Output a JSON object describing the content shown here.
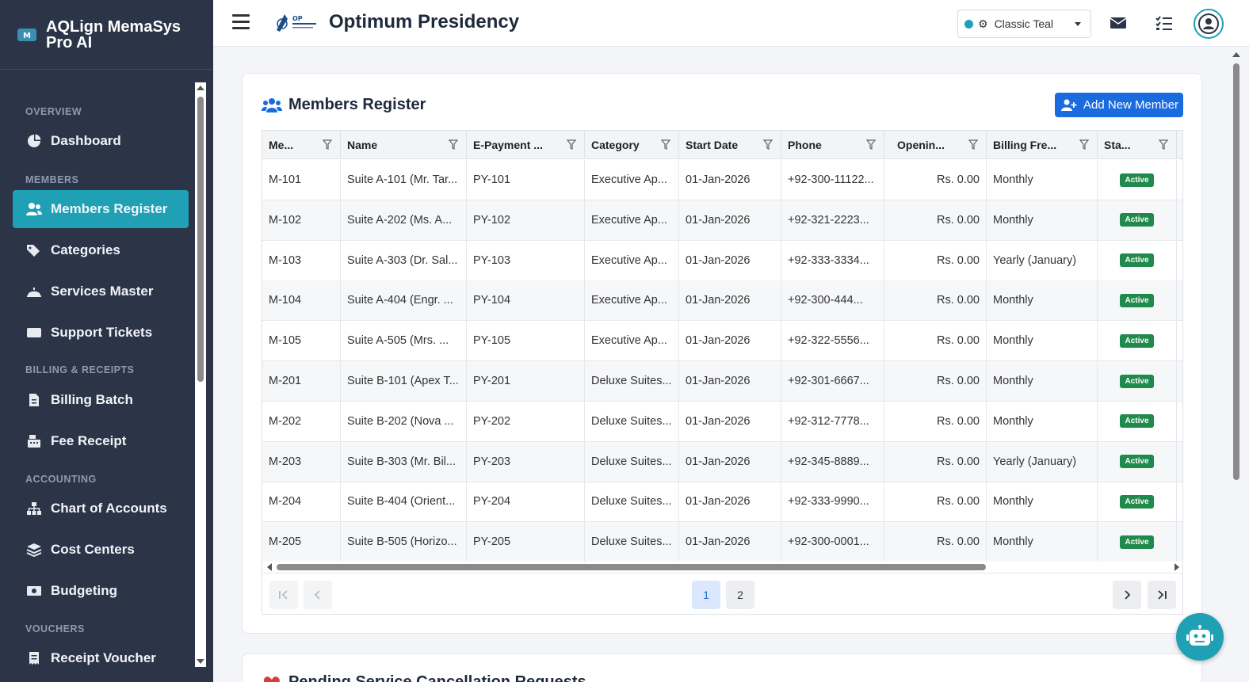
{
  "app": {
    "brand_name": "AQLign MemaSys Pro AI",
    "header_title": "Optimum Presidency",
    "theme": "Classic Teal",
    "accent_color": "#1fa0b4"
  },
  "sidebar": {
    "sections": [
      {
        "label": "OVERVIEW"
      },
      {
        "label": "MEMBERS"
      },
      {
        "label": "BILLING & RECEIPTS"
      },
      {
        "label": "ACCOUNTING"
      },
      {
        "label": "VOUCHERS"
      }
    ],
    "items": [
      {
        "label": "Dashboard",
        "icon": "pie-chart-icon"
      },
      {
        "label": "Members Register",
        "icon": "users-icon",
        "active": true
      },
      {
        "label": "Categories",
        "icon": "tags-icon"
      },
      {
        "label": "Services Master",
        "icon": "bell-service-icon"
      },
      {
        "label": "Support Tickets",
        "icon": "ticket-icon"
      },
      {
        "label": "Billing Batch",
        "icon": "file-invoice-icon"
      },
      {
        "label": "Fee Receipt",
        "icon": "cash-register-icon"
      },
      {
        "label": "Chart of Accounts",
        "icon": "sitemap-icon"
      },
      {
        "label": "Cost Centers",
        "icon": "layers-icon"
      },
      {
        "label": "Budgeting",
        "icon": "money-bill-icon"
      },
      {
        "label": "Receipt Voucher",
        "icon": "receipt-icon"
      }
    ]
  },
  "members_register": {
    "title": "Members Register",
    "add_button": "Add New Member",
    "columns": [
      "Me...",
      "Name",
      "E-Payment ...",
      "Category",
      "Start Date",
      "Phone",
      "Openin...",
      "Billing Fre...",
      "Sta..."
    ],
    "rows": [
      [
        "M-101",
        "Suite A-101 (Mr. Tar...",
        "PY-101",
        "Executive Ap...",
        "01-Jan-2026",
        "+92-300-11122...",
        "Rs. 0.00",
        "Monthly",
        "Active"
      ],
      [
        "M-102",
        "Suite A-202 (Ms. A...",
        "PY-102",
        "Executive Ap...",
        "01-Jan-2026",
        "+92-321-2223...",
        "Rs. 0.00",
        "Monthly",
        "Active"
      ],
      [
        "M-103",
        "Suite A-303 (Dr. Sal...",
        "PY-103",
        "Executive Ap...",
        "01-Jan-2026",
        "+92-333-3334...",
        "Rs. 0.00",
        "Yearly (January)",
        "Active"
      ],
      [
        "M-104",
        "Suite A-404 (Engr. ...",
        "PY-104",
        "Executive Ap...",
        "01-Jan-2026",
        "+92-300-444...",
        "Rs. 0.00",
        "Monthly",
        "Active"
      ],
      [
        "M-105",
        "Suite A-505 (Mrs. ...",
        "PY-105",
        "Executive Ap...",
        "01-Jan-2026",
        "+92-322-5556...",
        "Rs. 0.00",
        "Monthly",
        "Active"
      ],
      [
        "M-201",
        "Suite B-101 (Apex T...",
        "PY-201",
        "Deluxe Suites...",
        "01-Jan-2026",
        "+92-301-6667...",
        "Rs. 0.00",
        "Monthly",
        "Active"
      ],
      [
        "M-202",
        "Suite B-202 (Nova ...",
        "PY-202",
        "Deluxe Suites...",
        "01-Jan-2026",
        "+92-312-7778...",
        "Rs. 0.00",
        "Monthly",
        "Active"
      ],
      [
        "M-203",
        "Suite B-303 (Mr. Bil...",
        "PY-203",
        "Deluxe Suites...",
        "01-Jan-2026",
        "+92-345-8889...",
        "Rs. 0.00",
        "Yearly (January)",
        "Active"
      ],
      [
        "M-204",
        "Suite B-404 (Orient...",
        "PY-204",
        "Deluxe Suites...",
        "01-Jan-2026",
        "+92-333-9990...",
        "Rs. 0.00",
        "Monthly",
        "Active"
      ],
      [
        "M-205",
        "Suite B-505 (Horizo...",
        "PY-205",
        "Deluxe Suites...",
        "01-Jan-2026",
        "+92-300-0001...",
        "Rs. 0.00",
        "Monthly",
        "Active"
      ]
    ],
    "pagination": {
      "pages": [
        "1",
        "2"
      ],
      "current": "1"
    }
  },
  "second_card": {
    "title": "Pending Service Cancellation Requests"
  }
}
